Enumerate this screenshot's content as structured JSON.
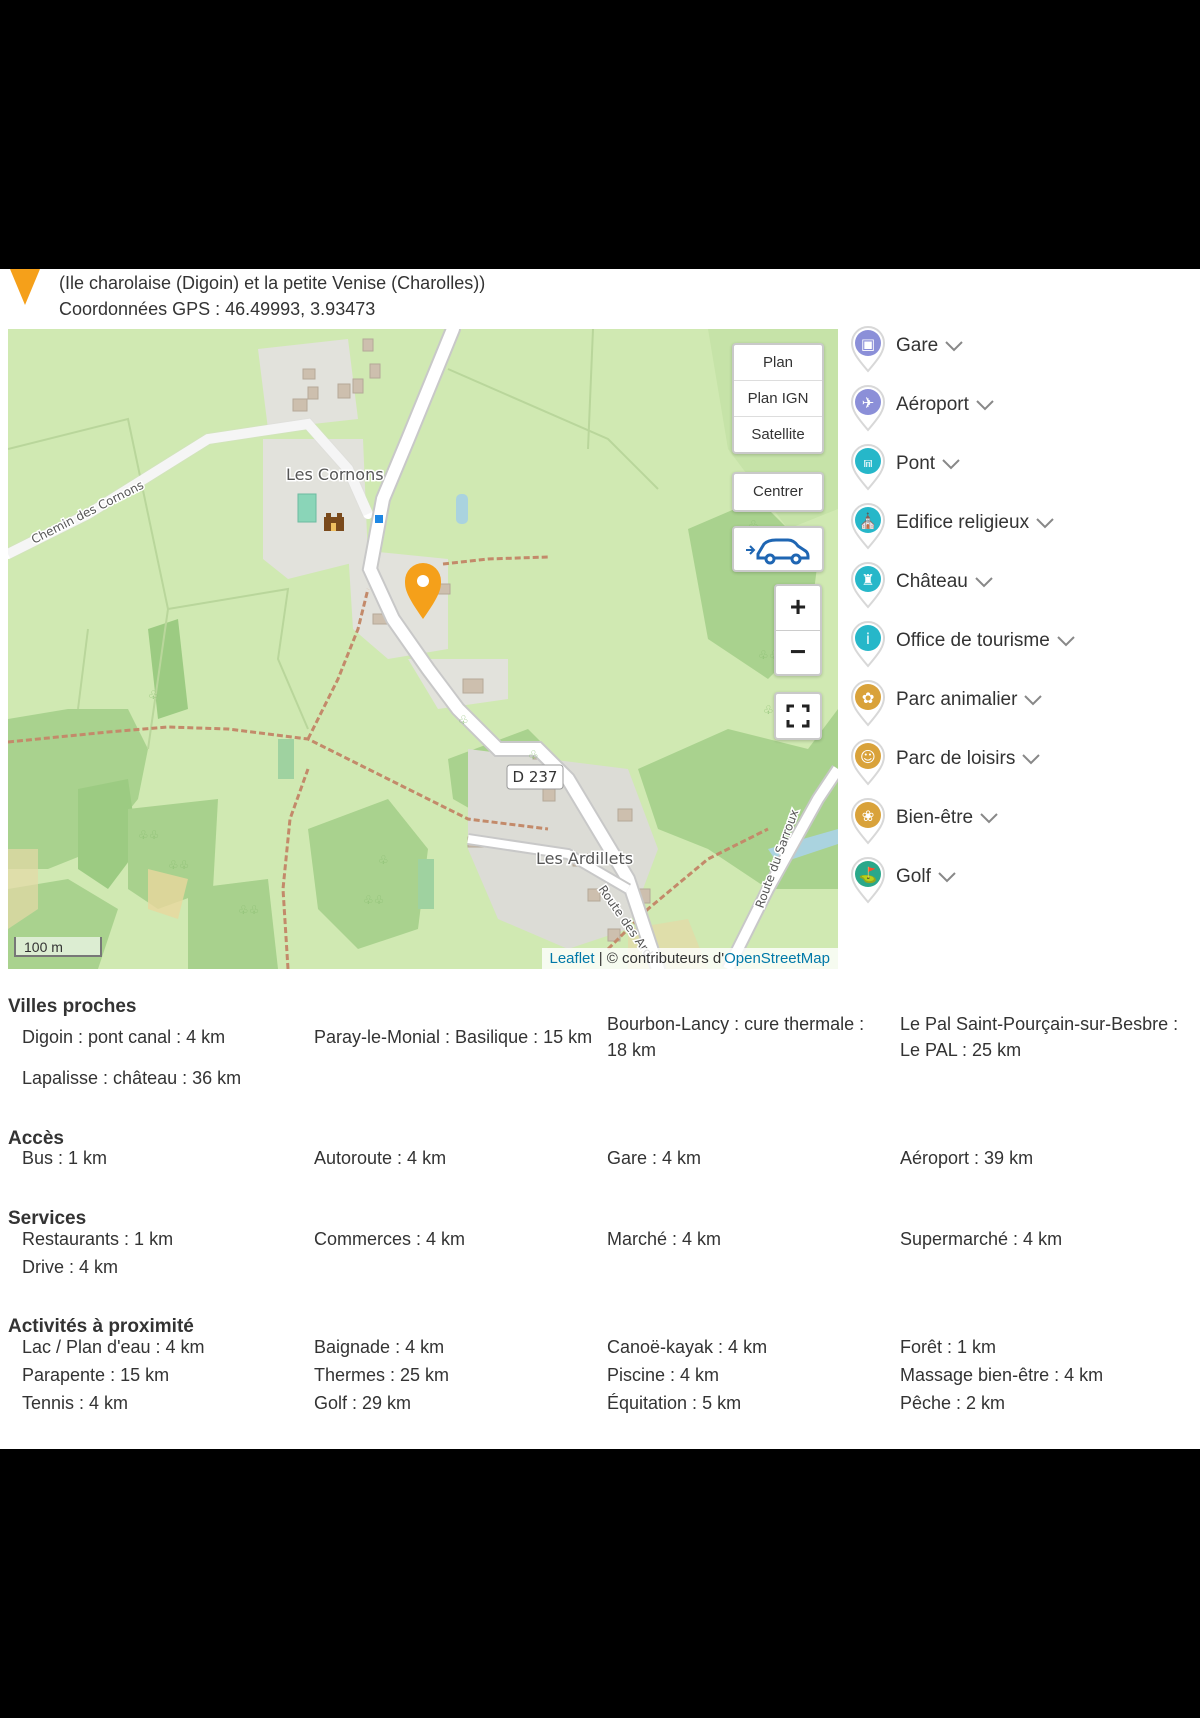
{
  "header": {
    "address_line": "(Ile charolaise (Digoin) et la petite Venise (Charolles))",
    "gps": "Coordonnées GPS : 46.49993, 3.93473"
  },
  "map": {
    "layers": [
      "Plan",
      "Plan IGN",
      "Satellite"
    ],
    "centrer_label": "Centrer",
    "zoom_in": "+",
    "zoom_out": "−",
    "scale": "100 m",
    "attribution": {
      "leaflet": "Leaflet",
      "sep": " | © contributeurs d'",
      "osm": "OpenStreetMap"
    },
    "place_labels": {
      "cornons": "Les Cornons",
      "ardillets": "Les Ardillets",
      "d237": "D 237",
      "chemin": "Chemin des Cornons",
      "route_sarroux": "Route du Sarroux",
      "route_ard": "Route des Ard"
    }
  },
  "poi_categories": [
    {
      "label": "Gare",
      "icon": "train-icon",
      "color": "#8b8fd8"
    },
    {
      "label": "Aéroport",
      "icon": "plane-icon",
      "color": "#8b8fd8"
    },
    {
      "label": "Pont",
      "icon": "bridge-icon",
      "color": "#26b7c9"
    },
    {
      "label": "Edifice religieux",
      "icon": "church-icon",
      "color": "#26b7c9"
    },
    {
      "label": "Château",
      "icon": "castle-icon",
      "color": "#26b7c9"
    },
    {
      "label": "Office de tourisme",
      "icon": "info-icon",
      "color": "#26b7c9"
    },
    {
      "label": "Parc animalier",
      "icon": "paw-icon",
      "color": "#d9a23a"
    },
    {
      "label": "Parc de loisirs",
      "icon": "smiley-icon",
      "color": "#d9a23a"
    },
    {
      "label": "Bien-être",
      "icon": "lotus-icon",
      "color": "#d9a23a"
    },
    {
      "label": "Golf",
      "icon": "golf-icon",
      "color": "#2aa88a"
    }
  ],
  "villes": {
    "title": "Villes proches",
    "items": [
      "Digoin : pont canal : 4 km",
      "Paray-le-Monial : Basilique : 15 km",
      "Bourbon-Lancy : cure thermale :",
      "18 km",
      "Le Pal Saint-Pourçain-sur-Besbre :",
      "Le PAL : 25 km",
      "Lapalisse : château : 36 km"
    ]
  },
  "acces": {
    "title": "Accès",
    "items": [
      "Bus : 1 km",
      "Autoroute : 4 km",
      "Gare : 4 km",
      "Aéroport : 39 km"
    ]
  },
  "services": {
    "title": "Services",
    "items": [
      "Restaurants : 1 km",
      "Commerces : 4 km",
      "Marché : 4 km",
      "Supermarché : 4 km",
      "Drive : 4 km"
    ]
  },
  "activites": {
    "title": "Activités à proximité",
    "items": [
      "Lac / Plan d'eau : 4 km",
      "Baignade : 4 km",
      "Canoë-kayak : 4 km",
      "Forêt : 1 km",
      "Parapente : 15 km",
      "Thermes : 25 km",
      "Piscine : 4 km",
      "Massage bien-être : 4 km",
      "Tennis : 4 km",
      "Golf : 29 km",
      "Équitation : 5 km",
      "Pêche : 2 km"
    ]
  }
}
